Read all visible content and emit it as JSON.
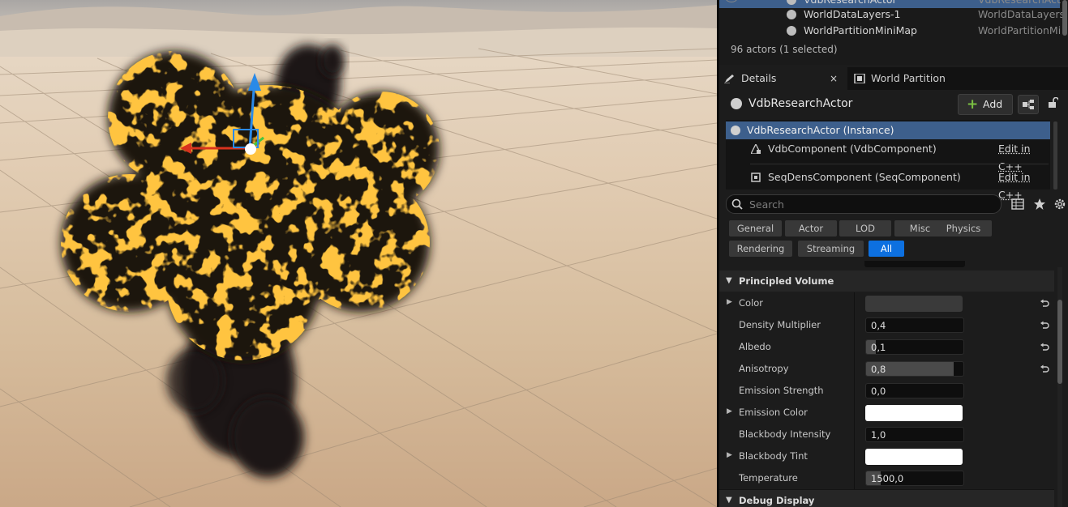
{
  "outliner": {
    "rows": [
      {
        "name": "VdbResearchActor",
        "type": "VdbResearchAct"
      },
      {
        "name": "WorldDataLayers-1",
        "type": "WorldDataLayers"
      },
      {
        "name": "WorldPartitionMiniMap",
        "type": "WorldPartitionMi"
      }
    ],
    "footer": "96 actors (1 selected)"
  },
  "tabs": [
    {
      "label": "Details",
      "close": "×"
    },
    {
      "label": "World Partition"
    }
  ],
  "details": {
    "actor_name": "VdbResearchActor",
    "add_label": "Add",
    "components": [
      {
        "label": "VdbResearchActor (Instance)"
      },
      {
        "label": "VdbComponent (VdbComponent)",
        "edit": "Edit in C++"
      },
      {
        "label": "SeqDensComponent (SeqComponent)",
        "edit": "Edit in C++"
      }
    ],
    "search_placeholder": "Search",
    "filters": [
      "General",
      "Actor",
      "LOD",
      "Misc",
      "Physics",
      "Rendering",
      "Streaming",
      "All"
    ],
    "active_filter": "All",
    "category": "Principled Volume",
    "category2": "Debug Display",
    "properties": [
      {
        "label": "Color",
        "kind": "color",
        "color": "#3a3a3a",
        "expandable": true,
        "reset": true
      },
      {
        "label": "Density Multiplier",
        "kind": "number",
        "value": "0,4",
        "reset": true
      },
      {
        "label": "Albedo",
        "kind": "slider",
        "value": "0,1",
        "fill": 0.1,
        "reset": true
      },
      {
        "label": "Anisotropy",
        "kind": "slider",
        "value": "0,8",
        "fill": 0.9,
        "reset": true
      },
      {
        "label": "Emission Strength",
        "kind": "number",
        "value": "0,0"
      },
      {
        "label": "Emission Color",
        "kind": "color",
        "color": "#ffffff",
        "expandable": true
      },
      {
        "label": "Blackbody Intensity",
        "kind": "number",
        "value": "1,0"
      },
      {
        "label": "Blackbody Tint",
        "kind": "color",
        "color": "#ffffff",
        "expandable": true
      },
      {
        "label": "Temperature",
        "kind": "slider",
        "value": "1500,0",
        "fill": 0.15
      }
    ]
  },
  "colors": {
    "selection": "#3d5f8c",
    "active_filter": "#0d70e0",
    "fire": "#ff9a1a",
    "smoke": "#1a1512"
  }
}
